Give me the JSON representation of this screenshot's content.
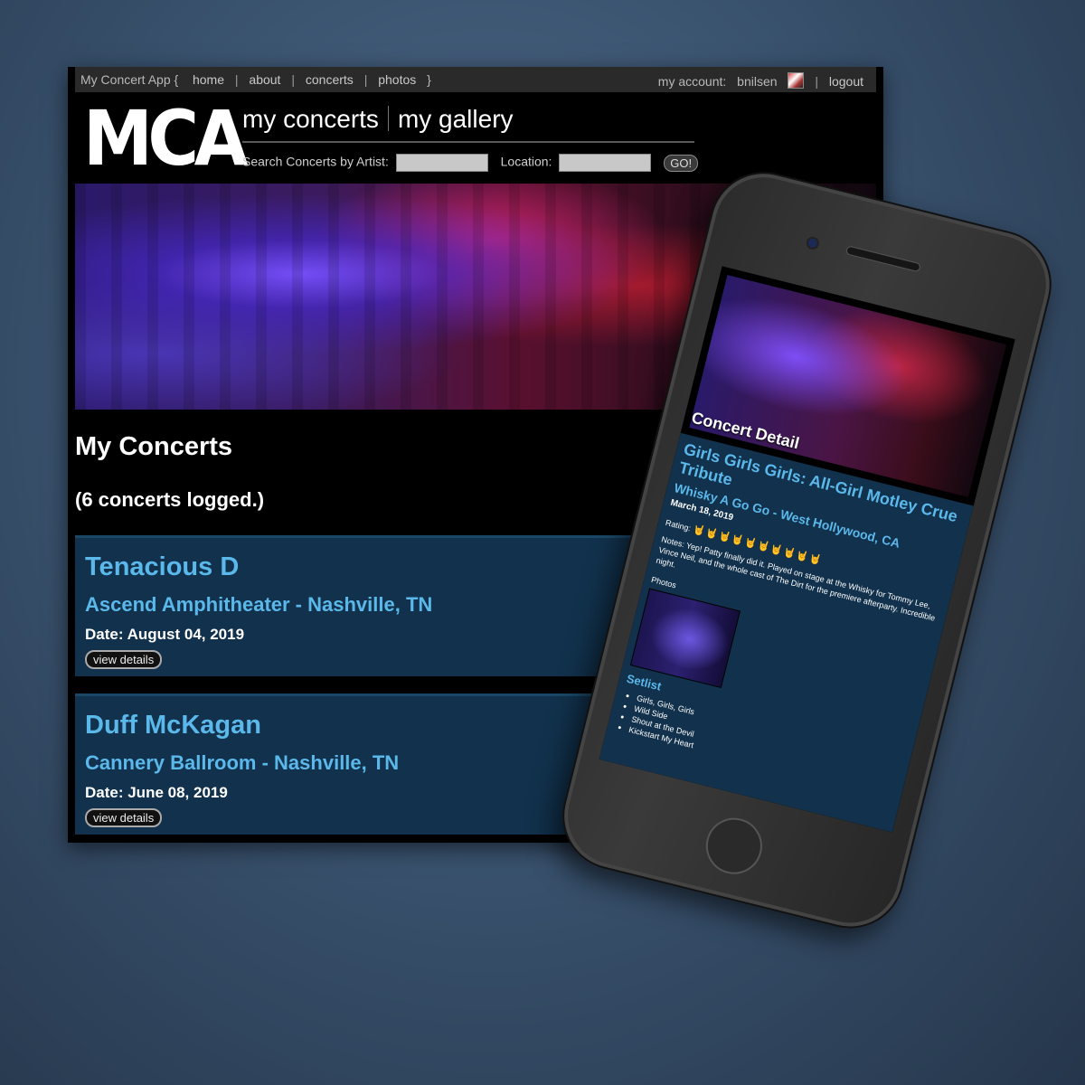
{
  "nav": {
    "app": "My Concert App {",
    "links": [
      "home",
      "about",
      "concerts",
      "photos"
    ],
    "close": "}",
    "account_label": "my account:",
    "username": "bnilsen",
    "logout": "logout"
  },
  "brand": {
    "logo": "MCA",
    "my_concerts": "my concerts",
    "my_gallery": "my gallery"
  },
  "search": {
    "artist_label": "Search Concerts by Artist:",
    "location_label": "Location:",
    "go": "GO!"
  },
  "main": {
    "title": "My Concerts",
    "count_text": "(6 concerts logged.)",
    "concerts": [
      {
        "artist": "Tenacious D",
        "venue": "Ascend Amphitheater - Nashville, TN",
        "date": "Date: August 04, 2019",
        "button": "view details"
      },
      {
        "artist": "Duff McKagan",
        "venue": "Cannery Ballroom - Nashville, TN",
        "date": "Date: June 08, 2019",
        "button": "view details"
      }
    ]
  },
  "phone": {
    "page_title": "Concert Detail",
    "event": "Girls Girls Girls: All-Girl Motley Crue Tribute",
    "venue": "Whisky A Go Go - West Hollywood, CA",
    "date": "March 18, 2019",
    "rating_label": "Rating:",
    "rating_value": 10,
    "rating_icons": "🤘🤘🤘🤘🤘🤘🤘🤘🤘🤘",
    "notes": "Notes: Yep! Patty finally did it. Played on stage at the Whisky for Tommy Lee, Vince Neil, and the whole cast of The Dirt for the premiere afterparty. Incredible night.",
    "photos_label": "Photos",
    "setlist_title": "Setlist",
    "setlist": [
      "Girls, Girls, Girls",
      "Wild Side",
      "Shout at the Devil",
      "Kickstart My Heart"
    ]
  }
}
